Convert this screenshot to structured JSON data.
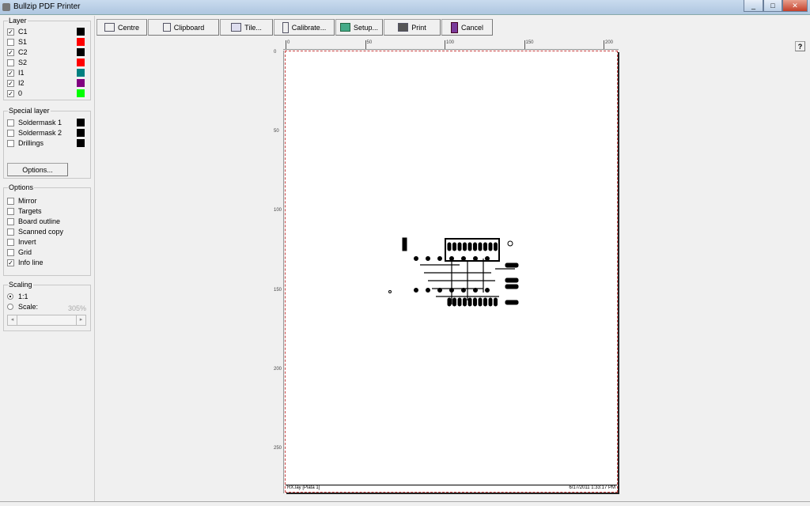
{
  "window": {
    "title": "Bullzip PDF Printer",
    "controls": [
      "_",
      "□",
      "✕"
    ]
  },
  "layer": {
    "title": "Layer",
    "items": [
      {
        "label": "C1",
        "checked": true,
        "color": "#000000"
      },
      {
        "label": "S1",
        "checked": false,
        "color": "#ff0000"
      },
      {
        "label": "C2",
        "checked": true,
        "color": "#000000"
      },
      {
        "label": "S2",
        "checked": false,
        "color": "#ff0000"
      },
      {
        "label": "I1",
        "checked": true,
        "color": "#008080"
      },
      {
        "label": "I2",
        "checked": true,
        "color": "#800080"
      },
      {
        "label": "0",
        "checked": true,
        "color": "#00ff00"
      }
    ]
  },
  "special": {
    "title": "Special layer",
    "items": [
      {
        "label": "Soldermask 1",
        "checked": false,
        "color": "#000000"
      },
      {
        "label": "Soldermask 2",
        "checked": false,
        "color": "#000000"
      },
      {
        "label": "Drillings",
        "checked": false,
        "color": "#000000"
      }
    ],
    "options_button": "Options..."
  },
  "options": {
    "title": "Options",
    "items": [
      {
        "label": "Mirror",
        "checked": false
      },
      {
        "label": "Targets",
        "checked": false
      },
      {
        "label": "Board outline",
        "checked": false
      },
      {
        "label": "Scanned copy",
        "checked": false
      },
      {
        "label": "Invert",
        "checked": false
      },
      {
        "label": "Grid",
        "checked": false
      },
      {
        "label": "Info line",
        "checked": true
      }
    ]
  },
  "scaling": {
    "title": "Scaling",
    "one_to_one": "1:1",
    "scale": "Scale:",
    "selected": "1:1",
    "scale_value": "305%"
  },
  "toolbar": {
    "centre": "Centre",
    "clipboard": "Clipboard",
    "tile": "Tile...",
    "calibrate": "Calibrate...",
    "setup": "Setup...",
    "print": "Print",
    "cancel": "Cancel"
  },
  "help": "?",
  "ruler": {
    "h": [
      "0",
      "50",
      "100",
      "150",
      "200"
    ],
    "v": [
      "0",
      "50",
      "100",
      "150",
      "200",
      "250"
    ]
  },
  "page": {
    "info_left": "RX.lay [Plata 1]",
    "info_right": "6/17/2011 1:33:17 PM"
  }
}
